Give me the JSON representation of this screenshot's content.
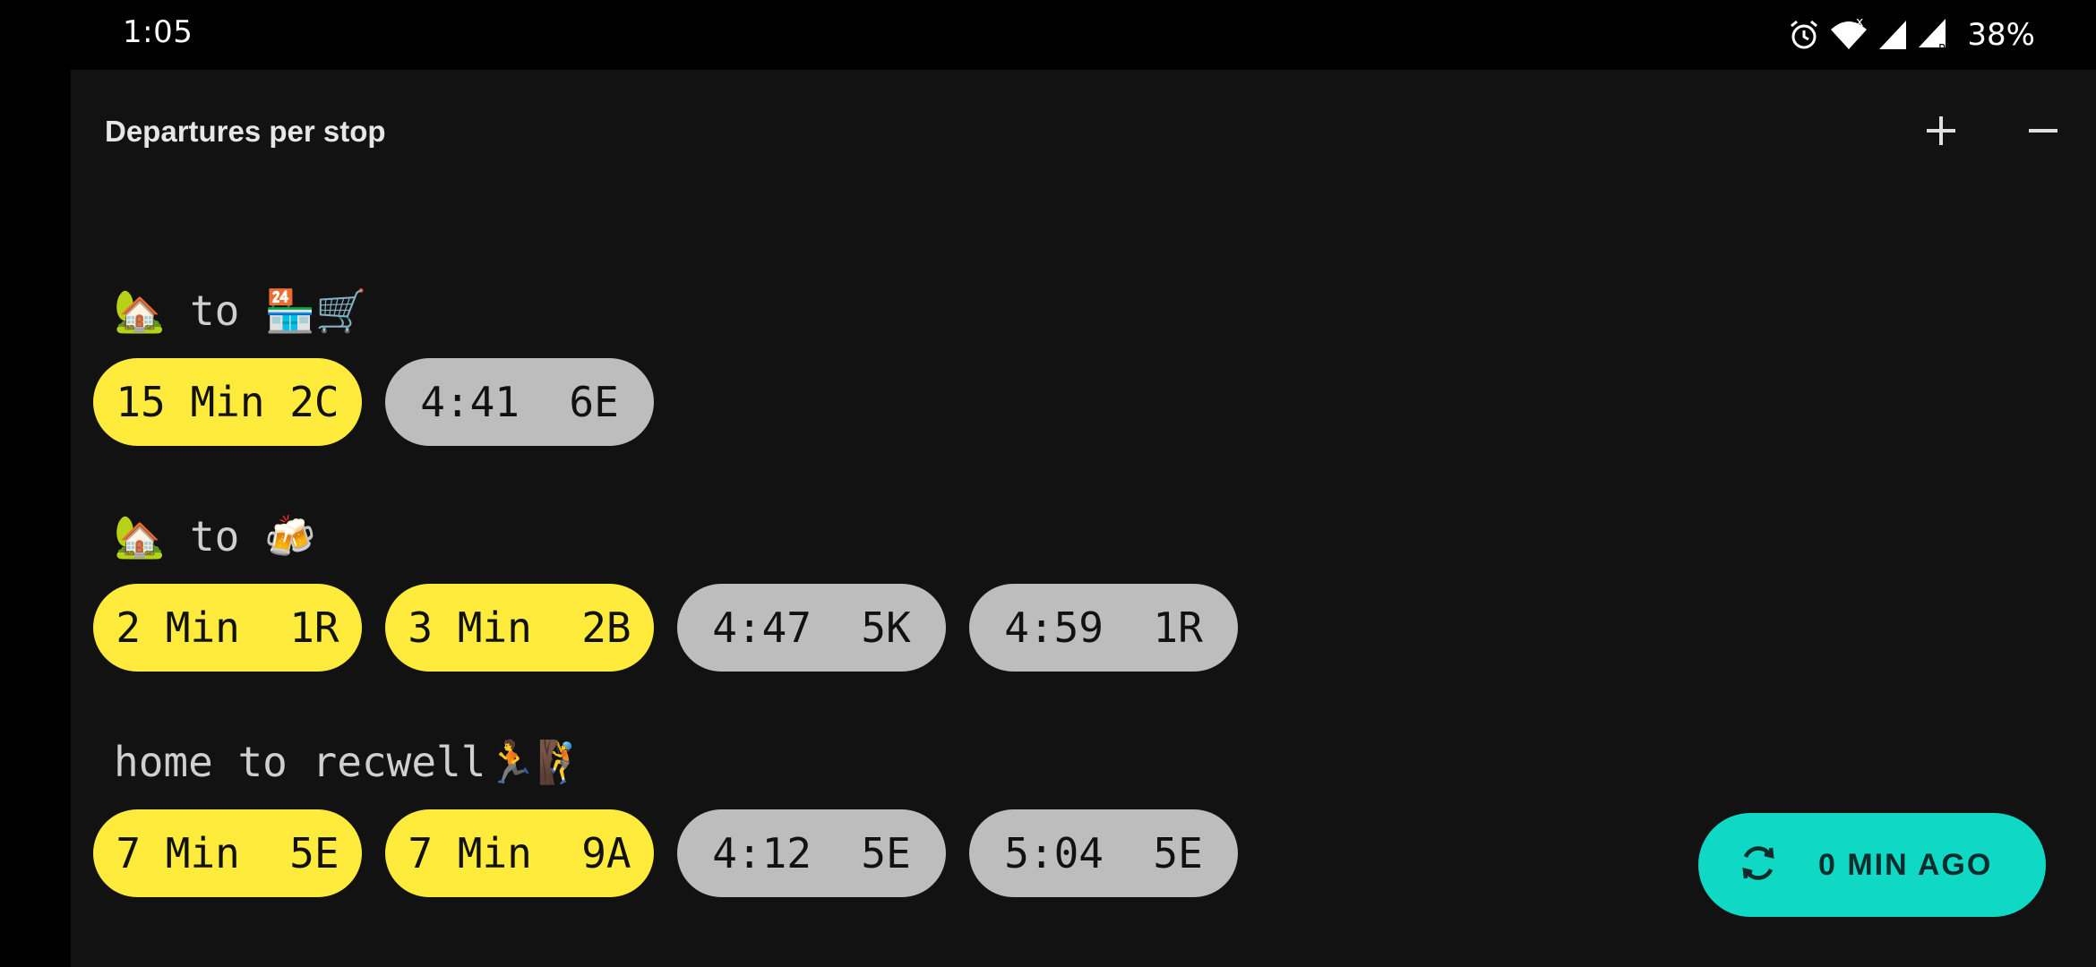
{
  "status_bar": {
    "time": "1:05",
    "battery": "38%",
    "icons": [
      "alarm-icon",
      "wifi-icon",
      "signal-x-icon",
      "signal-r-icon"
    ]
  },
  "app": {
    "title": "Departures per stop",
    "zoom_in_icon": "plus-icon",
    "zoom_out_icon": "minus-icon",
    "routes": [
      {
        "label": "🏡 to 🏪🛒",
        "departures": [
          {
            "text": "15 Min 2C",
            "style": "realtime"
          },
          {
            "text": "4:41  6E",
            "style": "scheduled"
          }
        ]
      },
      {
        "label": "🏡 to 🍻",
        "departures": [
          {
            "text": "2 Min  1R",
            "style": "realtime"
          },
          {
            "text": "3 Min  2B",
            "style": "realtime"
          },
          {
            "text": "4:47  5K",
            "style": "scheduled"
          },
          {
            "text": "4:59  1R",
            "style": "scheduled"
          }
        ]
      },
      {
        "label": "home to recwell🏃🧗",
        "departures": [
          {
            "text": "7 Min  5E",
            "style": "realtime"
          },
          {
            "text": "7 Min  9A",
            "style": "realtime"
          },
          {
            "text": "4:12  5E",
            "style": "scheduled"
          },
          {
            "text": "5:04  5E",
            "style": "scheduled"
          }
        ]
      }
    ],
    "refresh": {
      "icon": "refresh-icon",
      "label": "0 MIN AGO"
    }
  },
  "colors": {
    "realtime": "#ffeb3b",
    "scheduled": "#bdbdbd",
    "accent": "#0fd9c4",
    "background": "#121212"
  }
}
